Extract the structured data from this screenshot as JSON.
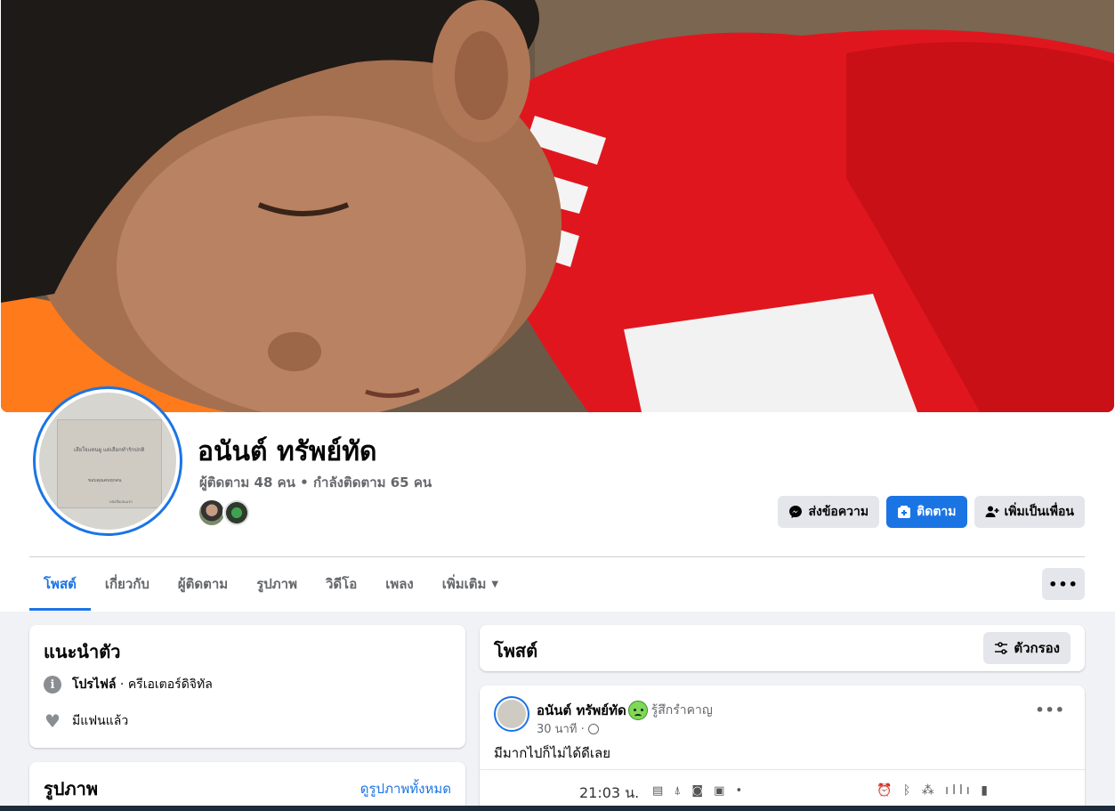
{
  "profile": {
    "name": "อนันต์ ทรัพย์ทัด",
    "stats": "ผู้ติดตาม 48 คน • กำลังติดตาม 65 คน",
    "avatar_text": {
      "line1": "เสียใจแทนผู แต่เลือกทำรักปกติ",
      "line2": "ขอบคุณคนทุกคน",
      "line3": "หนังสือเล่มแรก"
    }
  },
  "actions": {
    "message": "ส่งข้อความ",
    "follow": "ติดตาม",
    "add_friend": "เพิ่มเป็นเพื่อน"
  },
  "tabs": [
    {
      "label": "โพสต์",
      "active": true
    },
    {
      "label": "เกี่ยวกับ"
    },
    {
      "label": "ผู้ติดตาม"
    },
    {
      "label": "รูปภาพ"
    },
    {
      "label": "วิดีโอ"
    },
    {
      "label": "เพลง"
    },
    {
      "label": "เพิ่มเติม"
    }
  ],
  "tabs_more_icon": "more-dots-icon",
  "intro": {
    "title": "แนะนำตัว",
    "profile_label": "โปรไฟล์",
    "profile_value": " · ครีเอเตอร์ดิจิทัล",
    "relationship": "มีแฟนแล้ว"
  },
  "photos": {
    "title": "รูปภาพ",
    "see_all": "ดูรูปภาพทั้งหมด"
  },
  "posts": {
    "title": "โพสต์",
    "filter": "ตัวกรอง"
  },
  "post": {
    "author": "อนันต์ ทรัพย์ทัด",
    "feeling": "รู้สึกรำคาญ",
    "time": "30 นาที ·",
    "text": "มีมากไปก็ไม่ได้ดีเลย",
    "image_time": "21:03 น.",
    "image_icons_left": "▤ ⍋ ◙ ▣ •",
    "image_icons_right": "⏰ ᛒ ⁂ ıllı ▮"
  },
  "colors": {
    "accent": "#1b74e4",
    "page_bg": "#f0f2f5",
    "secondary_text": "#65676b"
  }
}
